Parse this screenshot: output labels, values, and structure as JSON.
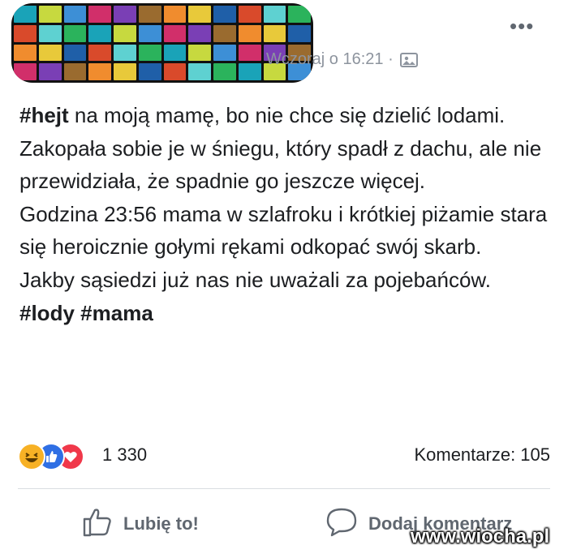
{
  "header": {
    "timestamp": "Wczoraj o 16:21 ·",
    "audience_icon": "group-photo-icon",
    "more_icon": "more-dots-icon",
    "censor_colors": [
      "#1aa3b8",
      "#e8c93a",
      "#3d8fd6",
      "#d94a2b",
      "#7a3fb5",
      "#2bb35c",
      "#f08c2e",
      "#c7d93f",
      "#1f5fa8",
      "#d12f6a",
      "#5ed1d1",
      "#9a6b2f"
    ]
  },
  "post": {
    "hashtag_hejt": "#hejt",
    "line1_rest": " na moją mamę, bo nie chce się dzielić lodami. Zakopała sobie je w śniegu, który spadł z dachu, ale nie przewidziała, że spadnie go jeszcze więcej.",
    "line2": "Godzina 23:56 mama w szlafroku i krótkiej piżamie  stara się heroicznie gołymi rękami odkopać swój skarb.",
    "line3": "Jakby sąsiedzi już nas nie uważali za pojebańców.",
    "hashtag_lody": "#lody",
    "hashtag_mama": "#mama"
  },
  "stats": {
    "reaction_icons": [
      "haha-icon",
      "like-icon",
      "love-icon"
    ],
    "reaction_count": "1 330",
    "comments": "Komentarze: 105"
  },
  "actions": {
    "like_label": "Lubię to!",
    "comment_label": "Dodaj komentarz"
  },
  "watermark": "www.wiocha.pl"
}
